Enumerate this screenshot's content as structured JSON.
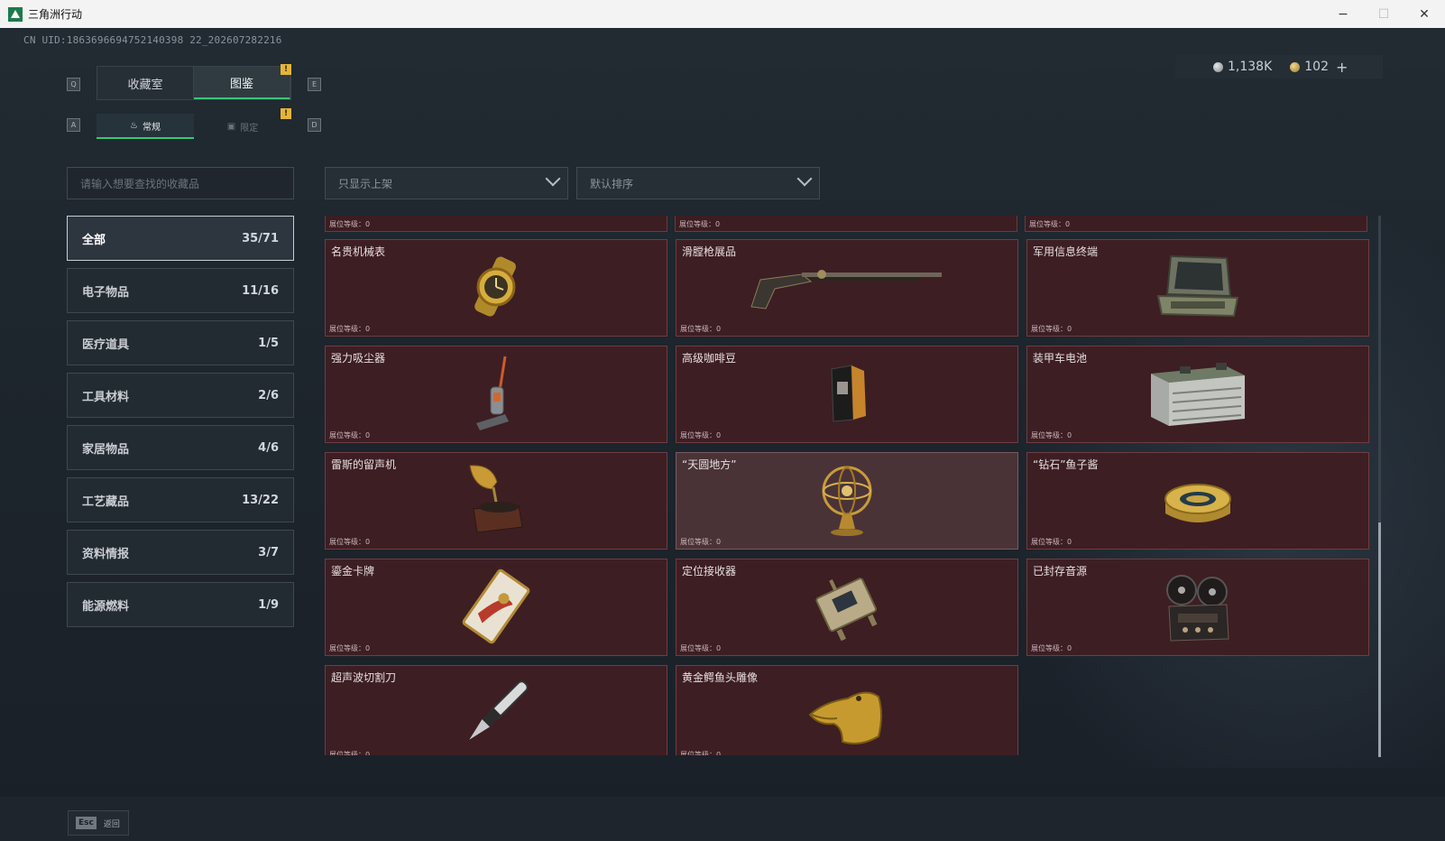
{
  "window": {
    "title": "三角洲行动",
    "min": "−",
    "max": "☐",
    "close": "✕"
  },
  "uid": "CN UID:1863696694752140398 22_202607282216",
  "currency": {
    "silver": "1,138K",
    "gold": "102",
    "plus": "+"
  },
  "keys": {
    "q": "Q",
    "e": "E",
    "a": "A",
    "d": "D"
  },
  "tabs": {
    "collection_room": "收藏室",
    "catalog": "图鉴",
    "badge": "!"
  },
  "subtabs": {
    "regular": "常规",
    "limited": "限定",
    "badge": "!"
  },
  "search": {
    "placeholder": "请输入想要查找的收藏品"
  },
  "filters": {
    "shelf": "只显示上架",
    "sort": "默认排序"
  },
  "categories": [
    {
      "label": "全部",
      "count": "35/71"
    },
    {
      "label": "电子物品",
      "count": "11/16"
    },
    {
      "label": "医疗道具",
      "count": "1/5"
    },
    {
      "label": "工具材料",
      "count": "2/6"
    },
    {
      "label": "家居物品",
      "count": "4/6"
    },
    {
      "label": "工艺藏品",
      "count": "13/22"
    },
    {
      "label": "资料情报",
      "count": "3/7"
    },
    {
      "label": "能源燃料",
      "count": "1/9"
    }
  ],
  "level_label": "展位等级：0",
  "items": [
    {
      "name": "名贵机械表",
      "icon": "watch-icon"
    },
    {
      "name": "滑膛枪展品",
      "icon": "musket-icon"
    },
    {
      "name": "军用信息终端",
      "icon": "terminal-icon"
    },
    {
      "name": "强力吸尘器",
      "icon": "vacuum-icon"
    },
    {
      "name": "高级咖啡豆",
      "icon": "coffee-bag-icon"
    },
    {
      "name": "装甲车电池",
      "icon": "battery-icon"
    },
    {
      "name": "雷斯的留声机",
      "icon": "gramophone-icon"
    },
    {
      "name": "“天圆地方”",
      "icon": "armillary-icon"
    },
    {
      "name": "“钻石”鱼子酱",
      "icon": "caviar-icon"
    },
    {
      "name": "鎏金卡牌",
      "icon": "card-icon"
    },
    {
      "name": "定位接收器",
      "icon": "receiver-icon"
    },
    {
      "name": "已封存音源",
      "icon": "reel-recorder-icon"
    },
    {
      "name": "超声波切割刀",
      "icon": "cutter-icon"
    },
    {
      "name": "黄金鳄鱼头雕像",
      "icon": "croc-statue-icon"
    }
  ],
  "footer": {
    "key": "Esc",
    "label": "返回"
  }
}
